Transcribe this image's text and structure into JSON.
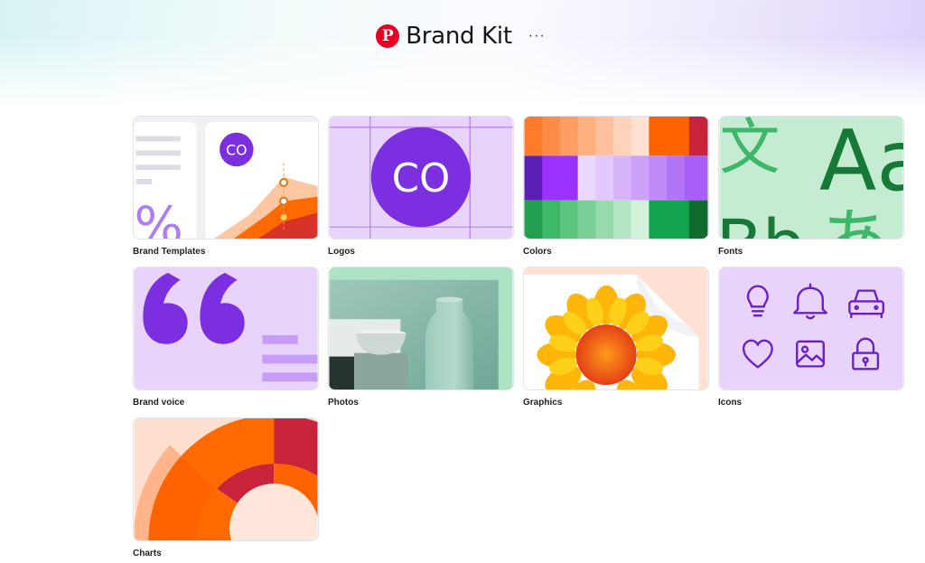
{
  "header": {
    "logo_letter": "P",
    "title": "Brand Kit",
    "more": "···"
  },
  "cards": [
    {
      "label": "Brand Templates",
      "thumb_text_logo": "CO",
      "thumb_text_percent": "%"
    },
    {
      "label": "Logos",
      "thumb_text_logo": "CO"
    },
    {
      "label": "Colors"
    },
    {
      "label": "Fonts",
      "thumb_text_1": "文",
      "thumb_text_2": "Aa",
      "thumb_text_3": "Bb",
      "thumb_text_4": "あ"
    },
    {
      "label": "Brand voice"
    },
    {
      "label": "Photos"
    },
    {
      "label": "Graphics"
    },
    {
      "label": "Icons"
    },
    {
      "label": "Charts"
    }
  ],
  "icons": [
    "lightbulb-icon",
    "bell-icon",
    "car-icon",
    "heart-icon",
    "image-icon",
    "lock-icon"
  ],
  "colors": {
    "brand_red": "#e60023",
    "purple": "#7b2fe0",
    "orange": "#ff6a00",
    "green": "#12a44c",
    "lavender": "#e8d4fb"
  }
}
